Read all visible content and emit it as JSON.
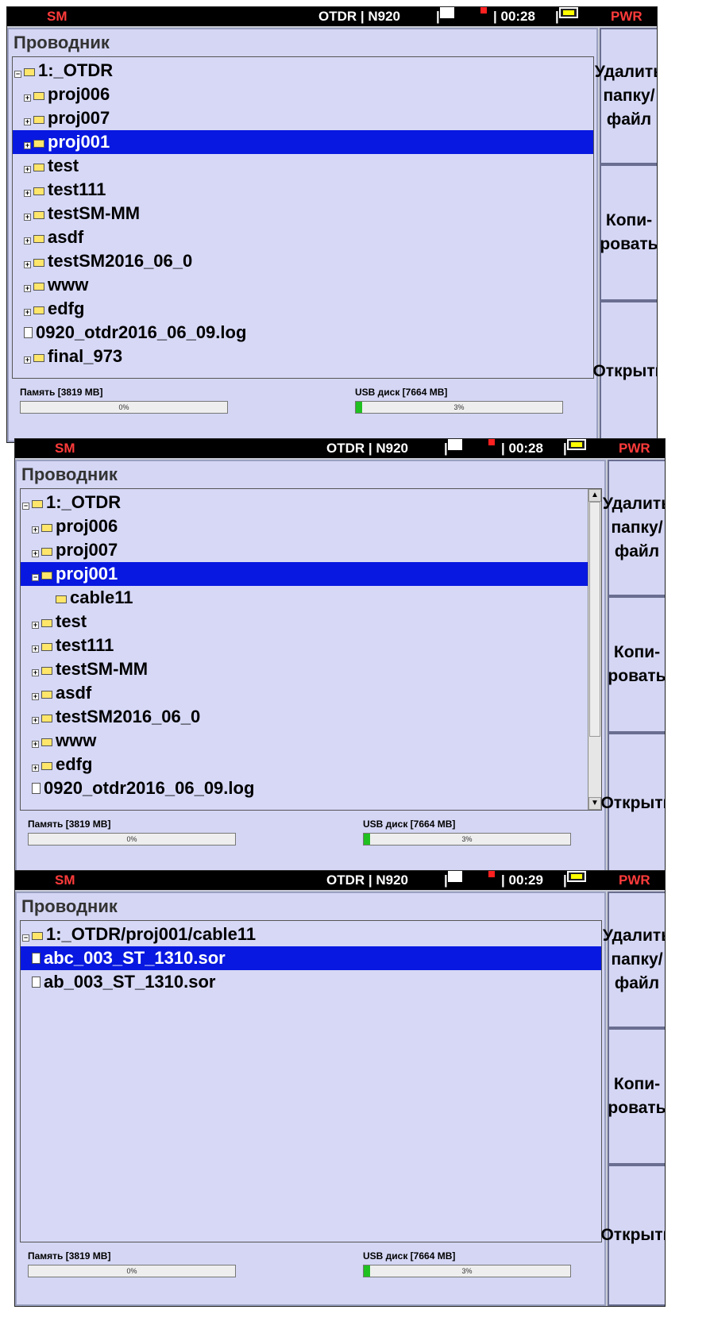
{
  "status": {
    "mode": "SM",
    "label": "OTDR",
    "model": "N920",
    "power": "PWR"
  },
  "explorer_title": "Проводник",
  "buttons": {
    "delete": "Удалить папку/ файл",
    "copy": "Копи- ровать",
    "open": "Открыть"
  },
  "memory": {
    "label": "Память [3819 MB]",
    "percent_text": "0%",
    "percent": 0
  },
  "usb": {
    "label": "USB диск [7664 MB]",
    "percent_text": "3%",
    "percent": 3
  },
  "screens": [
    {
      "time": "00:28",
      "rows": [
        {
          "text": "1:_OTDR",
          "kind": "root",
          "selected": false
        },
        {
          "text": "proj006",
          "kind": "folder",
          "selected": false
        },
        {
          "text": "proj007",
          "kind": "folder",
          "selected": false
        },
        {
          "text": "proj001",
          "kind": "folder",
          "selected": true
        },
        {
          "text": "test",
          "kind": "folder",
          "selected": false
        },
        {
          "text": "test111",
          "kind": "folder",
          "selected": false
        },
        {
          "text": "testSM-MM",
          "kind": "folder",
          "selected": false
        },
        {
          "text": "asdf",
          "kind": "folder",
          "selected": false
        },
        {
          "text": "testSM2016_06_0",
          "kind": "folder",
          "selected": false
        },
        {
          "text": "www",
          "kind": "folder",
          "selected": false
        },
        {
          "text": "edfg",
          "kind": "folder",
          "selected": false
        },
        {
          "text": "0920_otdr2016_06_09.log",
          "kind": "file",
          "selected": false
        },
        {
          "text": "final_973",
          "kind": "folder",
          "selected": false
        }
      ]
    },
    {
      "time": "00:28",
      "rows": [
        {
          "text": "1:_OTDR",
          "kind": "root",
          "selected": false
        },
        {
          "text": "proj006",
          "kind": "folder",
          "selected": false
        },
        {
          "text": "proj007",
          "kind": "folder",
          "selected": false
        },
        {
          "text": "proj001",
          "kind": "folder-open",
          "selected": true
        },
        {
          "text": "cable11",
          "kind": "subfolder",
          "selected": false
        },
        {
          "text": "test",
          "kind": "folder",
          "selected": false
        },
        {
          "text": "test111",
          "kind": "folder",
          "selected": false
        },
        {
          "text": "testSM-MM",
          "kind": "folder",
          "selected": false
        },
        {
          "text": "asdf",
          "kind": "folder",
          "selected": false
        },
        {
          "text": "testSM2016_06_0",
          "kind": "folder",
          "selected": false
        },
        {
          "text": "www",
          "kind": "folder",
          "selected": false
        },
        {
          "text": "edfg",
          "kind": "folder",
          "selected": false
        },
        {
          "text": "0920_otdr2016_06_09.log",
          "kind": "file",
          "selected": false
        }
      ]
    },
    {
      "time": "00:29",
      "rows": [
        {
          "text": "1:_OTDR/proj001/cable11",
          "kind": "root",
          "selected": false
        },
        {
          "text": "abc_003_ST_1310.sor",
          "kind": "file",
          "selected": true
        },
        {
          "text": "ab_003_ST_1310.sor",
          "kind": "file",
          "selected": false
        }
      ]
    }
  ]
}
